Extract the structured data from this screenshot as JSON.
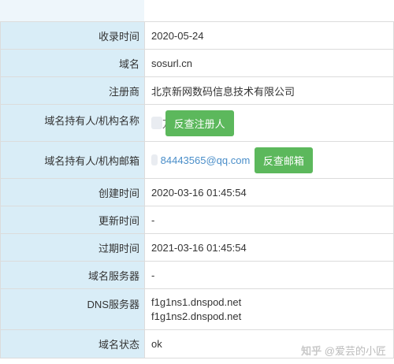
{
  "rows": [
    {
      "label": "收录时间",
      "value": "2020-05-24"
    },
    {
      "label": "域名",
      "value": "sosurl.cn"
    },
    {
      "label": "注册商",
      "value": "北京新网数码信息技术有限公司"
    },
    {
      "label": "域名持有人/机构名称",
      "value_partial": "万晨",
      "button": "反查注册人"
    },
    {
      "label": "域名持有人/机构邮箱",
      "value_partial": "84443565@qq.com",
      "button": "反查邮箱"
    },
    {
      "label": "创建时间",
      "value": "2020-03-16 01:45:54"
    },
    {
      "label": "更新时间",
      "value": "-"
    },
    {
      "label": "过期时间",
      "value": "2021-03-16 01:45:54"
    },
    {
      "label": "域名服务器",
      "value": "-"
    },
    {
      "label": "DNS服务器",
      "values": [
        "f1g1ns1.dnspod.net",
        "f1g1ns2.dnspod.net"
      ]
    },
    {
      "label": "域名状态",
      "value": "ok"
    }
  ],
  "watermark": {
    "logo": "知乎",
    "text": "@爱芸的小匠"
  }
}
